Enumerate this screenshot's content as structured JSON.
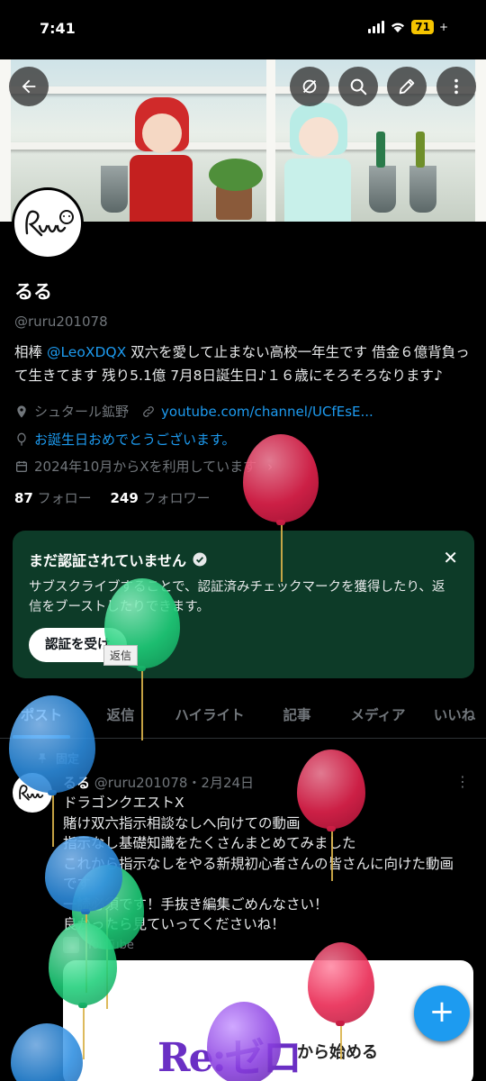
{
  "status": {
    "time": "7:41",
    "battery": "71"
  },
  "profile": {
    "name": "るる",
    "handle": "@ruru201078",
    "bio_mention": "@LeoXDQX",
    "bio_prefix": "相棒 ",
    "bio_rest_line1": " 双六を愛して止まない高校一年生です 借金６億背負っ",
    "bio_line2": "て生きてます 残り5.1億 7月8日誕生日♪１６歳にそろそろなります♪",
    "location": "シュタール鉱野",
    "url": "youtube.com/channel/UCfEsE...",
    "birthday_text": "お誕生日おめでとうございます。",
    "joined": "2024年10月からXを利用しています",
    "following_count": "87",
    "following_label": "フォロー",
    "followers_count": "249",
    "followers_label": "フォロワー"
  },
  "verify_card": {
    "title": "まだ認証されていません",
    "body": "サブスクライブすることで、認証済みチェックマークを獲得したり、返信をブーストしたりできます。",
    "button": "認証を受け"
  },
  "tooltip": "返信",
  "tabs": [
    {
      "label": "ポスト"
    },
    {
      "label": "返信"
    },
    {
      "label": "ハイライト"
    },
    {
      "label": "記事"
    },
    {
      "label": "メディア"
    },
    {
      "label": "いいね"
    }
  ],
  "post": {
    "pinned_label": "固定",
    "author": "るる",
    "handle_date": "@ruru201078・2月24日",
    "lines": [
      "ドラゴンクエストX",
      "賭け双六指示相談なしへ向けての動画",
      "指示なし基礎知識をたくさんまとめてみました",
      "これから指示なしをやる新規初心者さんの皆さんに向けた動画",
      "です",
      "一読必須です！手抜き編集ごめんなさい！",
      "良かったら見ていってくださいね！"
    ],
    "card_source": "YouTube",
    "card_title_main": "Re:ゼロ",
    "card_title_sub": "から始める"
  },
  "colors": {
    "accent": "#1d9bf0",
    "verify_bg": "#0d3b28",
    "balloon_red": "#e8244f",
    "balloon_green": "#1fcf7a",
    "balloon_blue": "#2e8ee0",
    "balloon_purple": "#8a3fe0"
  },
  "icons": {
    "back": "arrow-left-icon",
    "hide": "eye-off-icon",
    "search": "search-icon",
    "edit": "pencil-icon",
    "more": "more-vertical-icon",
    "location": "pin-icon",
    "link": "link-icon",
    "birthday": "balloon-icon",
    "calendar": "calendar-icon",
    "verified": "verified-badge-icon",
    "close": "close-icon",
    "pin": "pushpin-icon",
    "compose": "plus-icon"
  }
}
